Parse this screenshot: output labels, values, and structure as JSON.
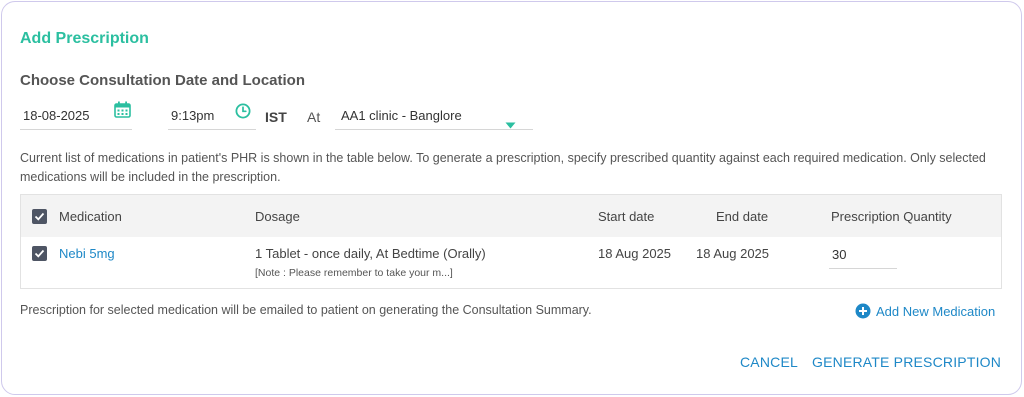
{
  "dialog": {
    "title": "Add Prescription",
    "section_title": "Choose Consultation Date and Location"
  },
  "consultation": {
    "date": "18-08-2025",
    "time": "9:13pm",
    "timezone": "IST",
    "at_label": "At",
    "location": "AA1 clinic - Banglore"
  },
  "info_text": "Current list of medications in patient's PHR is shown in the table below. To generate a prescription, specify prescribed quantity against each required medication. Only selected medications will be included in the prescription.",
  "table": {
    "headers": {
      "medication": "Medication",
      "dosage": "Dosage",
      "start_date": "Start date",
      "end_date": "End date",
      "quantity": "Prescription Quantity"
    },
    "rows": [
      {
        "selected": true,
        "medication": "Nebi 5mg",
        "dosage": "1 Tablet - once daily, At Bedtime (Orally)",
        "note": "[Note : Please remember to take your m...]",
        "start_date": "18 Aug 2025",
        "end_date": "18 Aug 2025",
        "quantity": "30"
      }
    ]
  },
  "footer_note": "Prescription for selected medication will be emailed to patient on generating the Consultation Summary.",
  "add_medication_label": "Add New Medication",
  "actions": {
    "cancel": "CANCEL",
    "generate": "GENERATE PRESCRIPTION"
  },
  "colors": {
    "title": "#2bbfa0",
    "link": "#1e88c7",
    "accent_teal": "#2bbfa0",
    "checkbox": "#4e5564"
  },
  "icons": {
    "date": "calendar-icon",
    "time": "clock-icon",
    "location": "dropdown-caret-icon",
    "add": "plus-circle-icon",
    "checkbox": "checkmark-icon"
  }
}
